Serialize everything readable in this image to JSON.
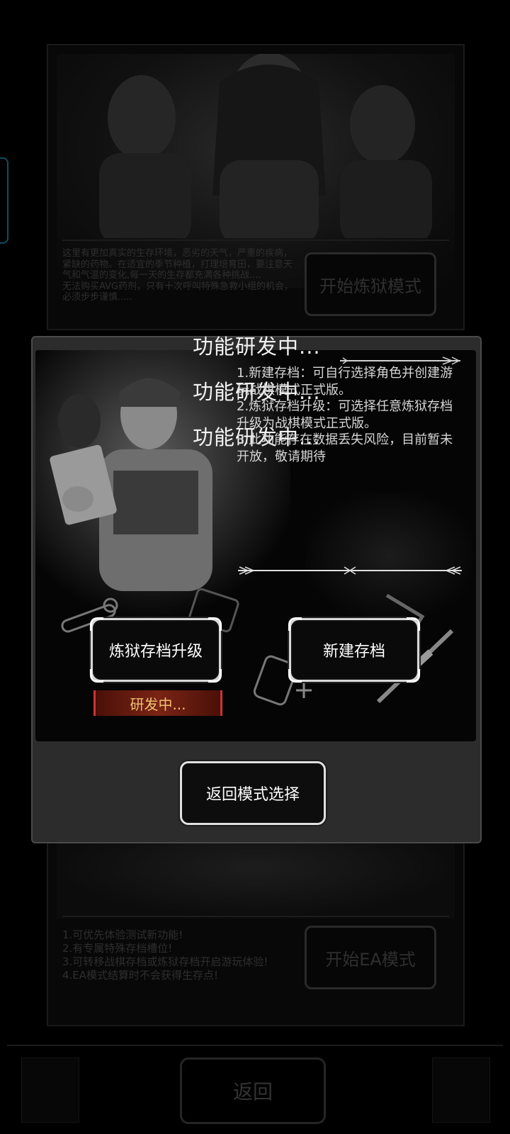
{
  "background": {
    "hell_mode": {
      "description": "这里有更加真实的生存环境，恶劣的天气，严重的疾病，紧缺的药物。在适宜的季节种植，打理培育田，要注意天气和气温的变化,每一天的生存都充满各种挑战....\n无法购买AVG药剂，只有十次呼叫特殊急救小组的机会，必须步步谨慎.....",
      "button_label": "开始炼狱模式"
    },
    "ea_mode": {
      "features": [
        "1.可优先体验测试新功能!",
        "2.有专属特殊存档槽位!",
        "3.可转移战棋存档或炼狱存档开启游玩体验!",
        "4.EA模式结算时不会获得生存点!"
      ],
      "button_label": "开始EA模式"
    },
    "back_label": "返回"
  },
  "modal": {
    "toasts": [
      "功能研发中...",
      "功能研发中...",
      "功能研发中..."
    ],
    "description": "1.新建存档：可自行选择角色并创建游玩战棋模式正式版。\n2.炼狱存档升级：可选择任意炼狱存档升级为战棋模式正式版。\n3.此功能存在数据丢失风险，目前暂未开放，敬请期待",
    "upgrade_button": "炼狱存档升级",
    "new_save_button": "新建存档",
    "dev_badge": "研发中...",
    "return_button": "返回模式选择"
  },
  "colors": {
    "modal_bg": "#2c2c2c",
    "panel_bg": "#050505",
    "badge_text": "#f0c070",
    "badge_bg": "#7a2414"
  }
}
